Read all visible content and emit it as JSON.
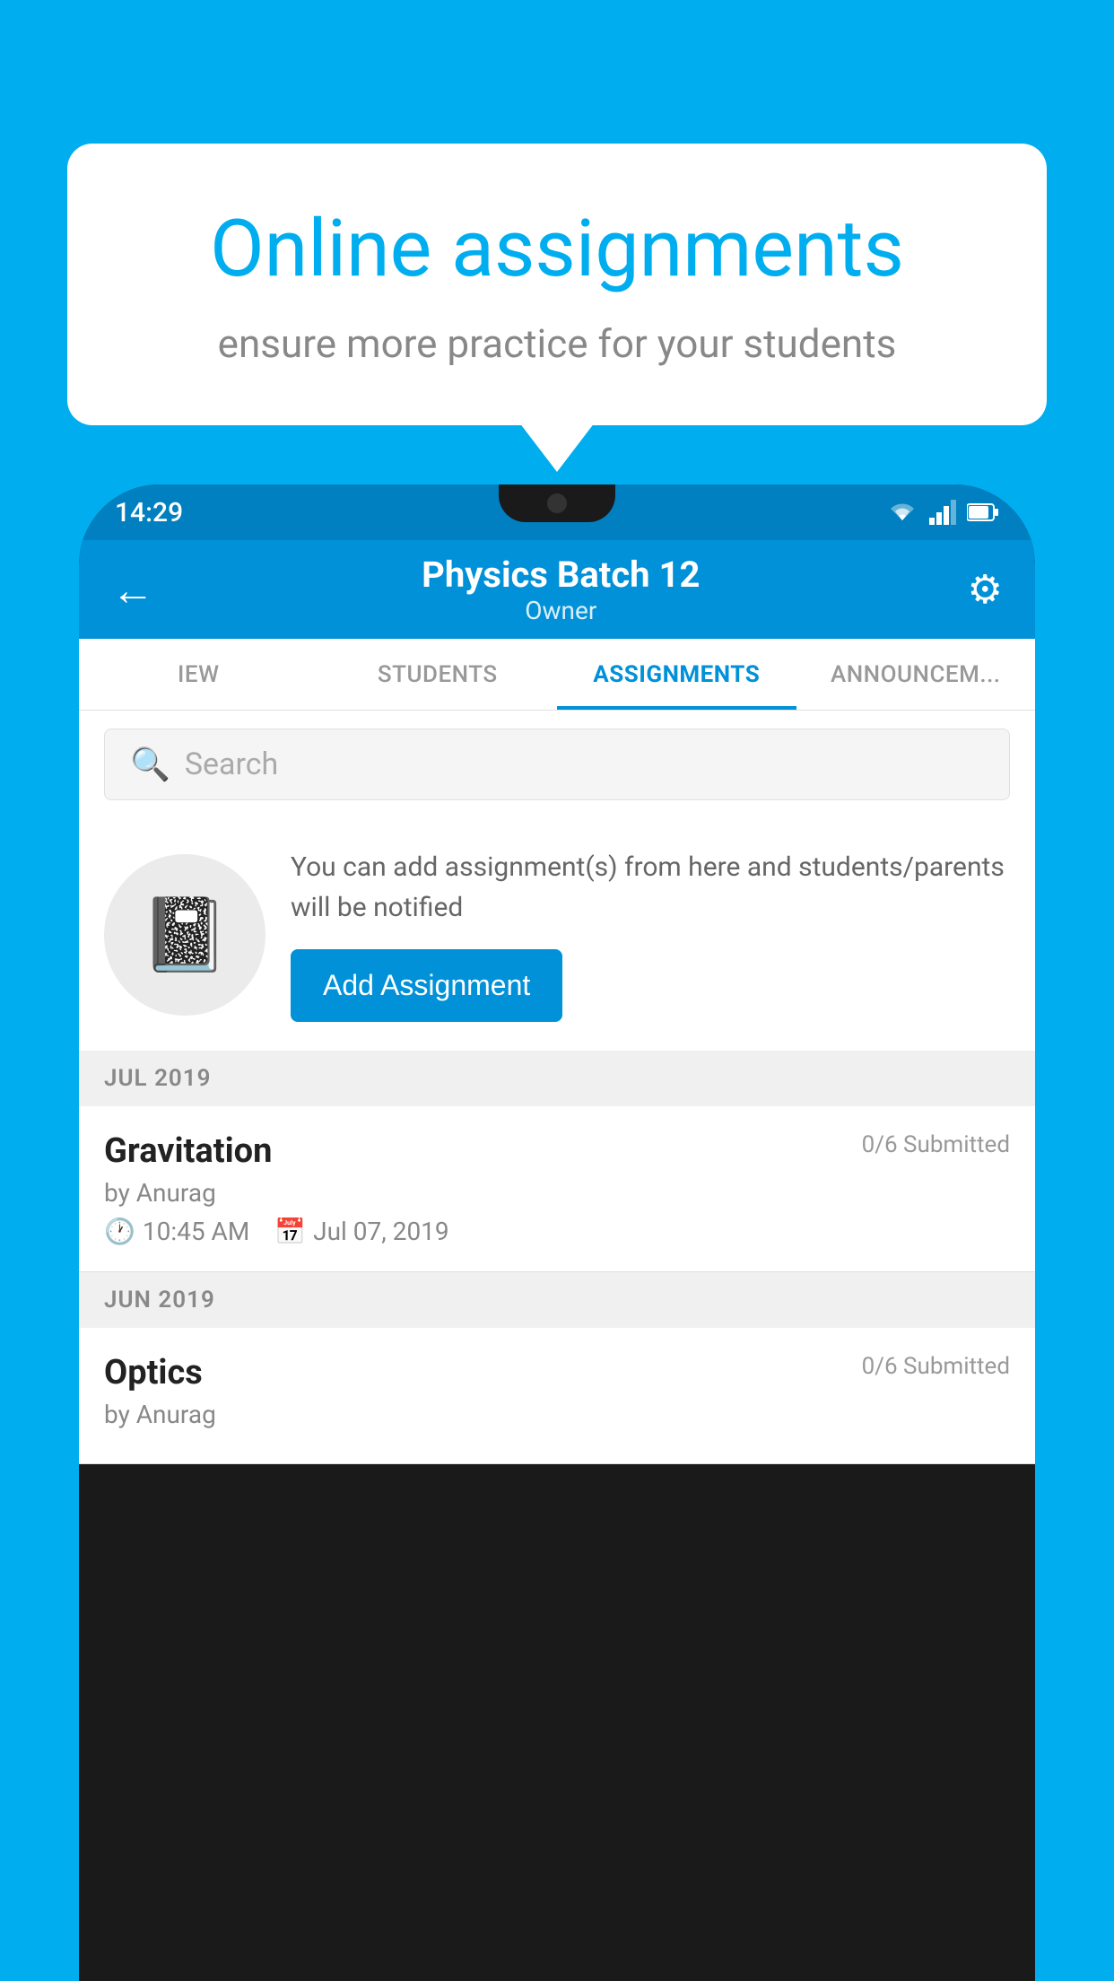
{
  "background_color": "#00AEEF",
  "speech_bubble": {
    "title": "Online assignments",
    "subtitle": "ensure more practice for your students"
  },
  "status_bar": {
    "time": "14:29"
  },
  "app_header": {
    "title": "Physics Batch 12",
    "subtitle": "Owner",
    "back_label": "←",
    "settings_label": "⚙"
  },
  "tabs": [
    {
      "label": "IEW",
      "active": false
    },
    {
      "label": "STUDENTS",
      "active": false
    },
    {
      "label": "ASSIGNMENTS",
      "active": true
    },
    {
      "label": "ANNOUNCEM...",
      "active": false
    }
  ],
  "search": {
    "placeholder": "Search"
  },
  "empty_state": {
    "description": "You can add assignment(s) from here and students/parents will be notified",
    "button_label": "Add Assignment"
  },
  "sections": [
    {
      "label": "JUL 2019",
      "assignments": [
        {
          "name": "Gravitation",
          "submitted": "0/6 Submitted",
          "by": "by Anurag",
          "time": "10:45 AM",
          "date": "Jul 07, 2019"
        }
      ]
    },
    {
      "label": "JUN 2019",
      "assignments": [
        {
          "name": "Optics",
          "submitted": "0/6 Submitted",
          "by": "by Anurag",
          "time": "",
          "date": ""
        }
      ]
    }
  ]
}
